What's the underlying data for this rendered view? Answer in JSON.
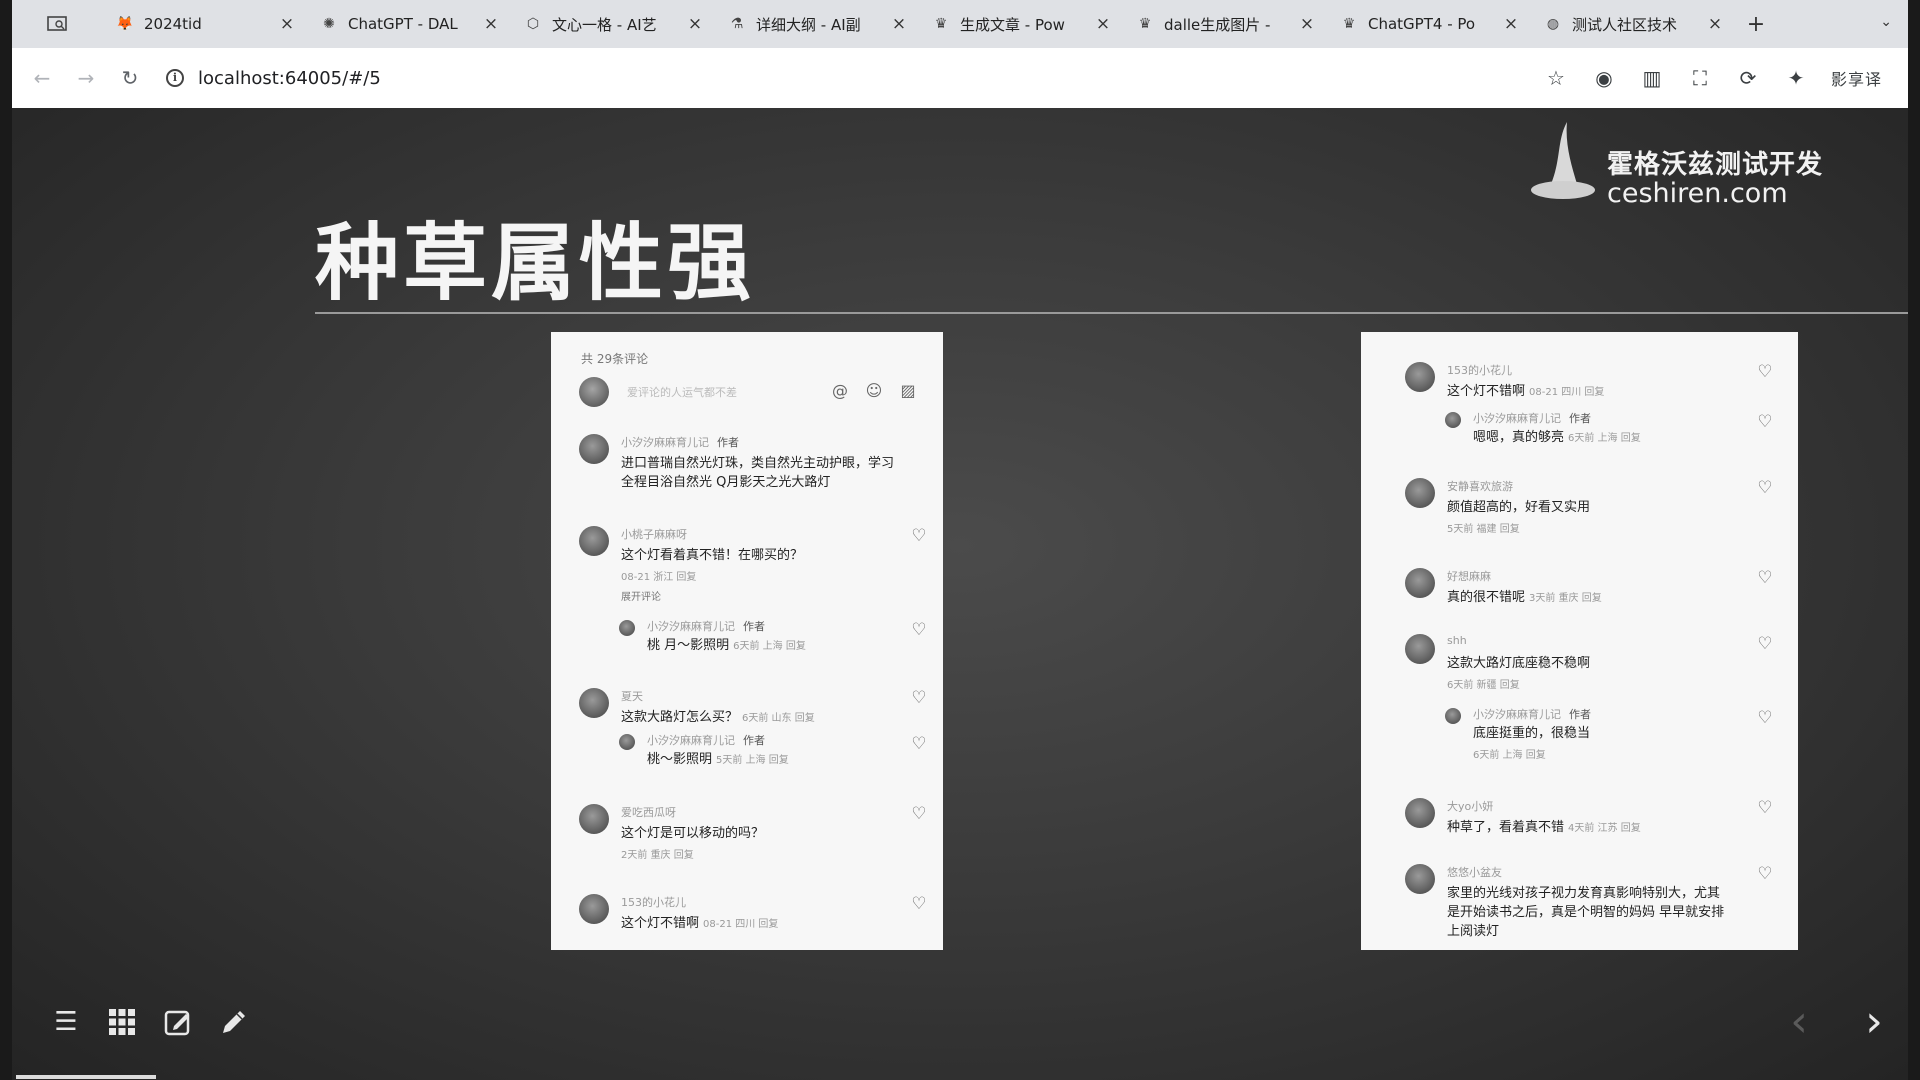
{
  "browser": {
    "tabs": [
      {
        "label": "2024tid",
        "icon": "fox-icon"
      },
      {
        "label": "ChatGPT - DAL",
        "icon": "openai-icon"
      },
      {
        "label": "文心一格 - AI艺",
        "icon": "cube-icon"
      },
      {
        "label": "详细大纲 - AI副",
        "icon": "flask-icon"
      },
      {
        "label": "生成文章 - Pow",
        "icon": "crown-icon"
      },
      {
        "label": "dalle生成图片 -",
        "icon": "crown-icon"
      },
      {
        "label": "ChatGPT4 - Po",
        "icon": "crown-icon"
      },
      {
        "label": "测试人社区技术",
        "icon": "globe-icon"
      }
    ],
    "close_glyph": "×",
    "new_tab_glyph": "+",
    "url": "localhost:64005/#/5",
    "extension_text": "影享译"
  },
  "slide": {
    "logo_line1": "霍格沃兹测试开发",
    "logo_line2": "ceshiren.com",
    "title": "种草属性强"
  },
  "left_shot": {
    "comment_count": "共 29条评论",
    "input_placeholder": "爱评论的人运气都不差",
    "comments": [
      {
        "name": "小汐汐麻麻育儿记",
        "author": "作者",
        "text": "进口普瑞自然光灯珠，类自然光主动护眼，学习全程目浴自然光 Q月影天之光大路灯",
        "meta": ""
      },
      {
        "name": "小桃子麻麻呀",
        "text": "这个灯看着真不错！在哪买的？",
        "meta": "08-21 浙江 回复",
        "more": "展开评论",
        "reply": {
          "name": "小汐汐麻麻育儿记",
          "author": "作者",
          "text": "桃 月～影照明",
          "meta": "6天前 上海 回复"
        }
      },
      {
        "name": "夏天",
        "text": "这款大路灯怎么买？",
        "meta": "6天前 山东 回复",
        "reply": {
          "name": "小汐汐麻麻育儿记",
          "author": "作者",
          "text": "桃～影照明",
          "meta": "5天前 上海 回复"
        }
      },
      {
        "name": "爱吃西瓜呀",
        "text": "这个灯是可以移动的吗？",
        "meta": "2天前 重庆 回复"
      },
      {
        "name": "153的小花儿",
        "text": "这个灯不错啊",
        "meta": "08-21 四川 回复"
      }
    ]
  },
  "right_shot": {
    "comments": [
      {
        "name": "153的小花儿",
        "text": "这个灯不错啊",
        "meta": "08-21 四川 回复",
        "reply": {
          "name": "小汐汐麻麻育儿记",
          "author": "作者",
          "text": "嗯嗯，真的够亮",
          "meta": "6天前 上海 回复"
        }
      },
      {
        "name": "安静喜欢旅游",
        "text": "颜值超高的，好看又实用",
        "meta": "5天前 福建 回复"
      },
      {
        "name": "好想麻麻",
        "text": "真的很不错呢",
        "meta": "3天前 重庆 回复"
      },
      {
        "name": "shh",
        "text": "这款大路灯底座稳不稳啊",
        "meta": "6天前 新疆 回复",
        "reply": {
          "name": "小汐汐麻麻育儿记",
          "author": "作者",
          "text": "底座挺重的，很稳当",
          "meta": "6天前 上海 回复"
        }
      },
      {
        "name": "大yo小妍",
        "text": "种草了，看着真不错",
        "meta": "4天前 江苏 回复"
      },
      {
        "name": "悠悠小盆友",
        "text": "家里的光线对孩子视力发育真影响特别大，尤其是开始读书之后，真是个明智的妈妈 早早就安排上阅读灯",
        "meta": ""
      }
    ]
  },
  "controls": {
    "menu_icon": "menu-icon",
    "grid_icon": "grid-icon",
    "edit_icon": "edit-icon",
    "pen_icon": "pen-icon"
  },
  "colors": {
    "slide_bg": "#3a3a3a",
    "title": "#f5f5f5",
    "tabstrip": "#dfe1e5"
  }
}
